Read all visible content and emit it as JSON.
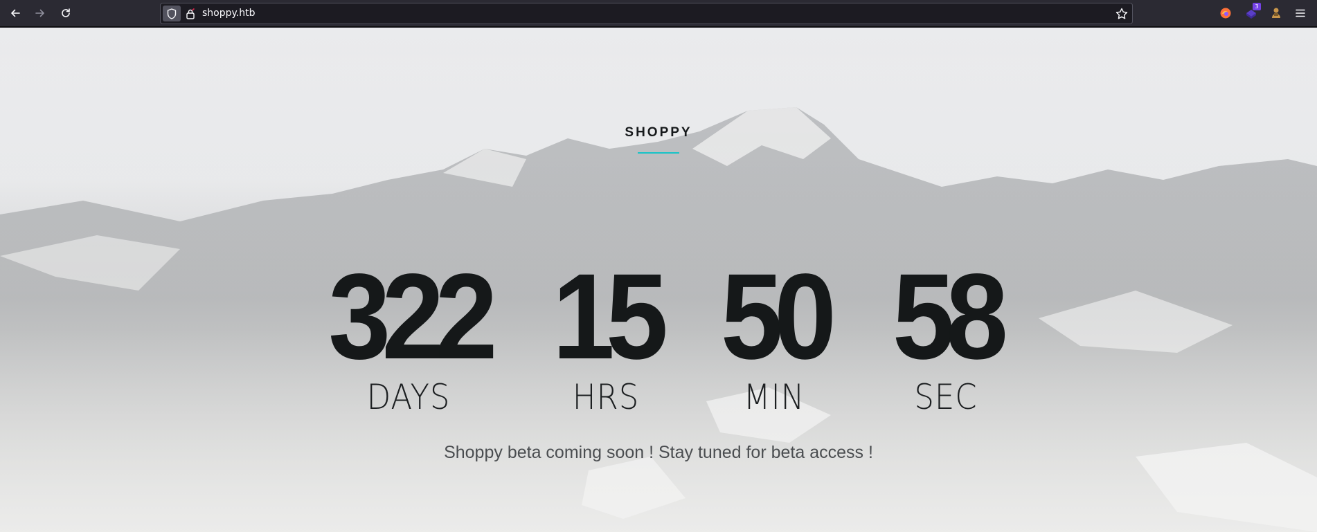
{
  "browser": {
    "url": "shoppy.htb",
    "extension_badge": "3",
    "icons": [
      "back-arrow-icon",
      "forward-arrow-icon",
      "reload-icon",
      "shield-icon",
      "lock-icon",
      "star-icon",
      "firefox-extension-icon",
      "extension-icon",
      "extension-puzzle-icon",
      "hamburger-menu-icon"
    ]
  },
  "page": {
    "brand": "SHOPPY",
    "accent_color": "#17c3c7",
    "countdown": [
      {
        "value": "322",
        "label": "DAYS"
      },
      {
        "value": "15",
        "label": "HRS"
      },
      {
        "value": "50",
        "label": "MIN"
      },
      {
        "value": "58",
        "label": "SEC"
      }
    ],
    "tagline": "Shoppy beta coming soon ! Stay tuned for beta access !"
  }
}
